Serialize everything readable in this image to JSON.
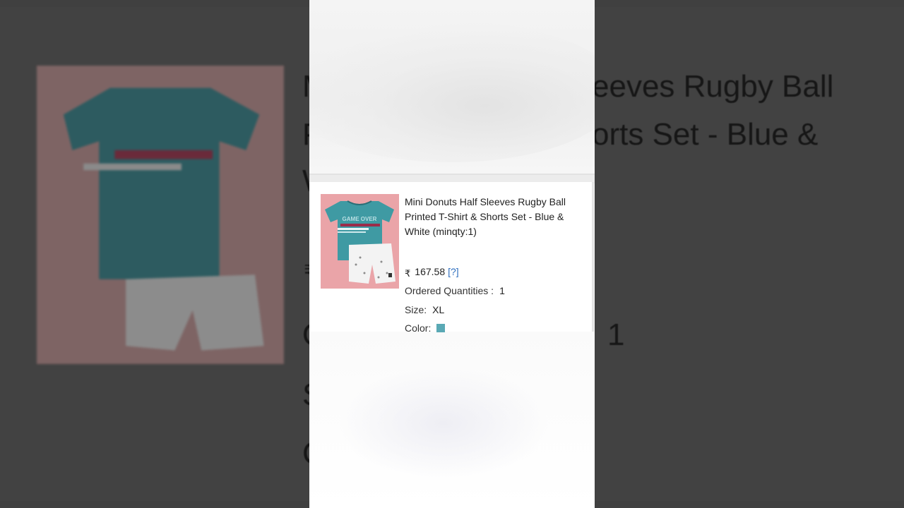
{
  "background": {
    "title_fragments": [
      "M",
      "eeves Rugby Ball",
      "P",
      "orts Set - Blue &",
      "W"
    ],
    "label_fragments": [
      "₹",
      "O",
      "1",
      "S",
      "C"
    ]
  },
  "product": {
    "title": "Mini Donuts Half Sleeves Rugby Ball Printed T-Shirt & Shorts Set - Blue & White (minqty:1)",
    "currency_symbol": "₹",
    "price": "167.58",
    "price_help": "[?]",
    "ordered_quantities_label": "Ordered Quantities :",
    "ordered_quantities_value": "1",
    "size_label": "Size:",
    "size_value": "XL",
    "color_label": "Color:",
    "color_swatch": "#5aa9b5",
    "image_icon": "tshirt-shorts-product-image"
  }
}
